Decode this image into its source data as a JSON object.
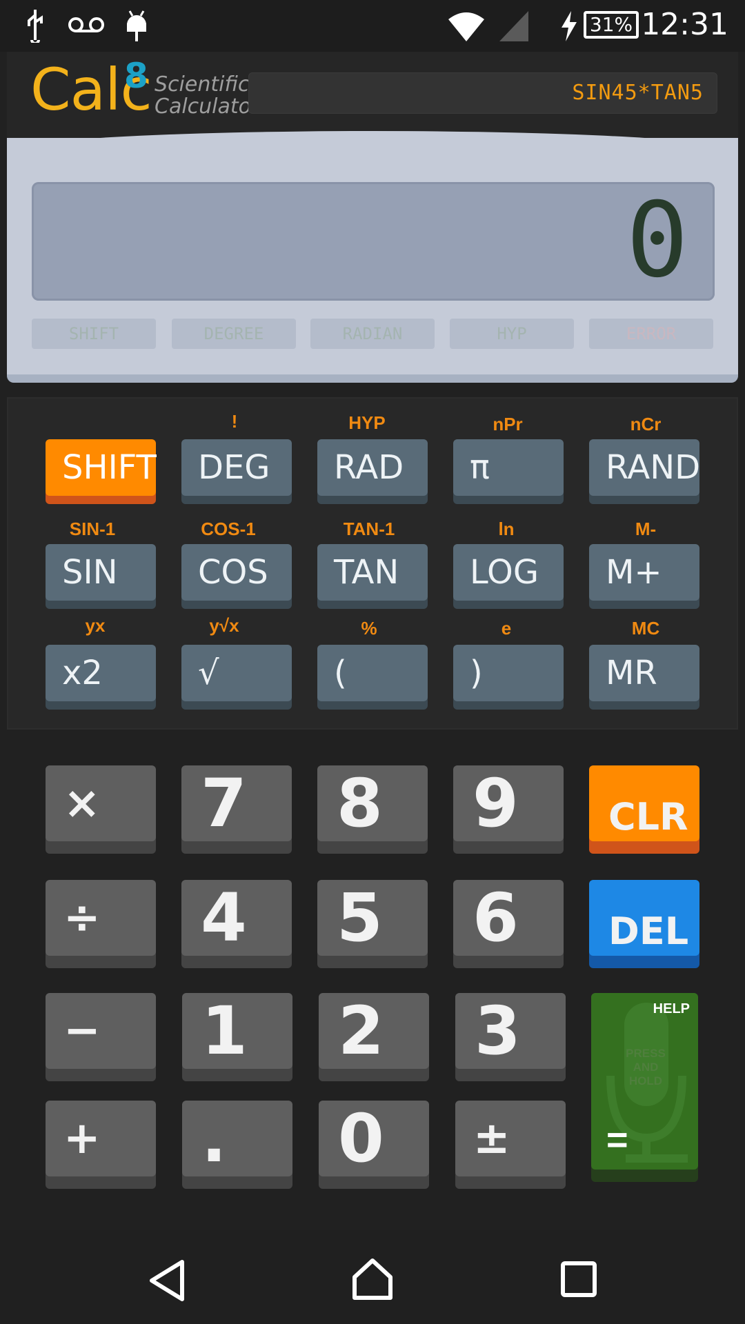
{
  "status_bar": {
    "time": "12:31",
    "battery": "31%",
    "icons": [
      "usb-icon",
      "voicemail-icon",
      "android-debug-icon",
      "wifi-icon",
      "signal-icon",
      "charging-icon"
    ]
  },
  "header": {
    "logo": "Calc",
    "logo_sup": "8",
    "logo_sub_line1": "Scientific",
    "logo_sub_line2": "Calculator",
    "expression": "SIN45*TAN5"
  },
  "display": {
    "value": "0",
    "indicators": [
      "SHIFT",
      "DEGREE",
      "RADIAN",
      "HYP",
      "ERROR"
    ]
  },
  "sci_rows": [
    {
      "labels": [
        "",
        "!",
        "HYP",
        "nPr",
        "nCr"
      ],
      "keys": [
        "SHIFT",
        "DEG",
        "RAD",
        "π",
        "RAND"
      ]
    },
    {
      "labels": [
        "SIN-1",
        "COS-1",
        "TAN-1",
        "ln",
        "M-"
      ],
      "keys": [
        "SIN",
        "COS",
        "TAN",
        "LOG",
        "M+"
      ]
    },
    {
      "labels": [
        "yx",
        "y√x",
        "%",
        "e",
        "MC"
      ],
      "keys": [
        "x2",
        "√",
        "(",
        ")",
        "MR"
      ]
    }
  ],
  "num_rows": [
    [
      "×",
      "7",
      "8",
      "9",
      "CLR"
    ],
    [
      "÷",
      "4",
      "5",
      "6",
      "DEL"
    ],
    [
      "−",
      "1",
      "2",
      "3"
    ],
    [
      "+",
      ".",
      "0",
      "±"
    ]
  ],
  "equals_key": {
    "help": "HELP",
    "press_and_hold": "PRESS AND HOLD",
    "symbol": "="
  },
  "colors": {
    "accent_orange": "#ff8a00",
    "del_blue": "#1e88e5",
    "equals_green": "#34701f",
    "sci_key": "#596b78",
    "num_key": "#5f5f5f"
  }
}
